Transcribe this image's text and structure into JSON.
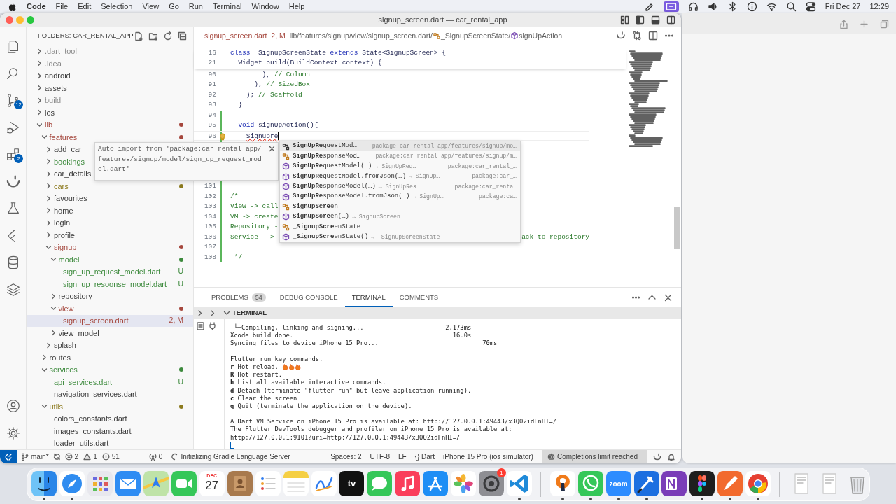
{
  "menu_bar": {
    "app": "Code",
    "items": [
      "File",
      "Edit",
      "Selection",
      "View",
      "Go",
      "Run",
      "Terminal",
      "Window",
      "Help"
    ],
    "date": "Fri Dec 27",
    "time": "12:29"
  },
  "window": {
    "title": "signup_screen.dart — car_rental_app"
  },
  "activity_bar": [
    {
      "kind": "files"
    },
    {
      "kind": "search"
    },
    {
      "kind": "source_control",
      "badge": "12"
    },
    {
      "kind": "run"
    },
    {
      "kind": "extensions",
      "badge": "2"
    },
    {
      "kind": "smile"
    },
    {
      "kind": "testing"
    },
    {
      "kind": "flutter"
    },
    {
      "kind": "database"
    },
    {
      "kind": "layers"
    }
  ],
  "activity_bottom": [
    {
      "kind": "account"
    },
    {
      "kind": "settings"
    }
  ],
  "sidebar": {
    "title": "FOLDERS: CAR_RENTAL_APP",
    "tree": [
      {
        "label": ".dart_tool",
        "kind": "folder",
        "expanded": false,
        "selected": false,
        "color": "#8a8a8a"
      },
      {
        "label": ".idea",
        "kind": "folder",
        "expanded": false,
        "selected": false,
        "color": "#8a8a8a"
      },
      {
        "label": "android",
        "kind": "folder",
        "expanded": false,
        "selected": false
      },
      {
        "label": "assets",
        "kind": "folder",
        "expanded": false,
        "selected": false
      },
      {
        "label": "build",
        "kind": "folder",
        "expanded": false,
        "selected": false,
        "color": "#8a8a8a"
      },
      {
        "label": "ios",
        "kind": "folder",
        "expanded": false,
        "selected": false
      },
      {
        "label": "lib",
        "kind": "folder",
        "expanded": true,
        "selected": false,
        "color": "#a5473d",
        "dot": true,
        "children": [
          {
            "label": "features",
            "kind": "folder",
            "expanded": true,
            "selected": false,
            "color": "#a5473d",
            "dot": true,
            "children": [
              {
                "label": "add_car",
                "kind": "folder",
                "expanded": false,
                "selected": false
              },
              {
                "label": "bookings",
                "kind": "folder",
                "expanded": false,
                "selected": false,
                "color": "#3d8a3d"
              },
              {
                "label": "car_details",
                "kind": "folder",
                "expanded": false,
                "selected": false
              },
              {
                "label": "cars",
                "kind": "folder",
                "expanded": false,
                "selected": false,
                "color": "#8c7a1e",
                "dot": true
              },
              {
                "label": "favourites",
                "kind": "folder",
                "expanded": false,
                "selected": false
              },
              {
                "label": "home",
                "kind": "folder",
                "expanded": false,
                "selected": false
              },
              {
                "label": "login",
                "kind": "folder",
                "expanded": false,
                "selected": false
              },
              {
                "label": "profile",
                "kind": "folder",
                "expanded": false,
                "selected": false
              },
              {
                "label": "signup",
                "kind": "folder",
                "expanded": true,
                "selected": false,
                "color": "#a5473d",
                "dot": true,
                "children": [
                  {
                    "label": "model",
                    "kind": "folder",
                    "expanded": true,
                    "selected": false,
                    "color": "#3d8a3d",
                    "dot": true,
                    "children": [
                      {
                        "label": "sign_up_request_model.dart",
                        "kind": "file",
                        "selected": false,
                        "color": "#3d8a3d",
                        "badge": "U"
                      },
                      {
                        "label": "sign_up_resoonse_model.dart",
                        "kind": "file",
                        "selected": false,
                        "color": "#3d8a3d",
                        "badge": "U"
                      }
                    ]
                  },
                  {
                    "label": "repository",
                    "kind": "folder",
                    "expanded": false,
                    "selected": false
                  },
                  {
                    "label": "view",
                    "kind": "folder",
                    "expanded": true,
                    "selected": false,
                    "color": "#a5473d",
                    "dot": true,
                    "children": [
                      {
                        "label": "signup_screen.dart",
                        "kind": "file",
                        "selected": true,
                        "color": "#a5473d",
                        "badge": "2, M"
                      }
                    ]
                  },
                  {
                    "label": "view_model",
                    "kind": "folder",
                    "expanded": false,
                    "selected": false
                  }
                ]
              },
              {
                "label": "splash",
                "kind": "folder",
                "expanded": false,
                "selected": false
              }
            ]
          },
          {
            "label": "routes",
            "kind": "folder",
            "expanded": false,
            "selected": false
          },
          {
            "label": "services",
            "kind": "folder",
            "expanded": true,
            "selected": false,
            "color": "#3d8a3d",
            "dot": true,
            "children": [
              {
                "label": "api_services.dart",
                "kind": "file",
                "selected": false,
                "color": "#3d8a3d",
                "badge": "U"
              },
              {
                "label": "navigation_services.dart",
                "kind": "file",
                "selected": false
              }
            ]
          },
          {
            "label": "utils",
            "kind": "folder",
            "expanded": true,
            "selected": false,
            "color": "#8c7a1e",
            "dot": true,
            "children": [
              {
                "label": "colors_constants.dart",
                "kind": "file",
                "selected": false
              },
              {
                "label": "images_constants.dart",
                "kind": "file",
                "selected": false
              },
              {
                "label": "loader_utils.dart",
                "kind": "file",
                "selected": false
              }
            ]
          }
        ]
      }
    ]
  },
  "editor": {
    "file": "signup_screen.dart",
    "file_status": "2, M",
    "breadcrumb": [
      "lib/features/signup/view/signup_screen.dart/",
      "_SignupScreenState/",
      "signUpAction"
    ],
    "sticky_lines": [
      {
        "number": "16",
        "tokens": [
          {
            "text": "class",
            "kind": "keyword"
          },
          {
            "text": " _SignupScreenState ",
            "kind": "plain"
          },
          {
            "text": "extends",
            "kind": "keyword"
          },
          {
            "text": " State<SignupScreen> {",
            "kind": "plain"
          }
        ]
      },
      {
        "number": "21",
        "tokens": [
          {
            "text": "  Widget build(BuildContext context) {",
            "kind": "plain"
          }
        ]
      }
    ],
    "lines": [
      {
        "number": "90",
        "changed": false,
        "tokens": [
          {
            "text": "        ), ",
            "kind": "plain"
          },
          {
            "text": "// Column",
            "kind": "comment"
          }
        ]
      },
      {
        "number": "91",
        "changed": false,
        "tokens": [
          {
            "text": "      ), ",
            "kind": "plain"
          },
          {
            "text": "// SizedBox",
            "kind": "comment"
          }
        ]
      },
      {
        "number": "92",
        "changed": false,
        "tokens": [
          {
            "text": "    ); ",
            "kind": "plain"
          },
          {
            "text": "// Scaffold",
            "kind": "comment"
          }
        ]
      },
      {
        "number": "93",
        "changed": false,
        "tokens": [
          {
            "text": "  }",
            "kind": "plain"
          }
        ]
      },
      {
        "number": "94",
        "changed": true
      },
      {
        "number": "95",
        "changed": true,
        "tokens": [
          {
            "text": "  void",
            "kind": "keyword"
          },
          {
            "text": " signUpAction(){",
            "kind": "plain"
          }
        ]
      },
      {
        "number": "96",
        "changed": true,
        "current": true,
        "lightbulb": true,
        "tokens": [
          {
            "text": "    Signupre",
            "kind": "error"
          }
        ]
      },
      {
        "number": "101",
        "changed": true,
        "after_covered_rows": true
      },
      {
        "number": "102",
        "changed": true,
        "tokens": [
          {
            "text": "/*",
            "kind": "comment"
          }
        ]
      },
      {
        "number": "103",
        "changed": true,
        "tokens": [
          {
            "text": "View -> call",
            "kind": "comment"
          }
        ]
      },
      {
        "number": "104",
        "changed": true,
        "tokens": [
          {
            "text": "VM -> create",
            "kind": "comment"
          }
        ]
      },
      {
        "number": "105",
        "changed": true,
        "tokens": [
          {
            "text": "Repository -",
            "kind": "comment"
          }
        ]
      },
      {
        "number": "106",
        "changed": true,
        "tokens": [
          {
            "text": "Service  ->",
            "kind": "comment"
          }
        ],
        "tail": "ack to repository"
      },
      {
        "number": "107",
        "changed": true
      },
      {
        "number": "108",
        "changed": true,
        "tokens": [
          {
            "text": " */",
            "kind": "comment"
          }
        ]
      }
    ],
    "hover": {
      "text": "Auto import from 'package:car_rental_app/\nfeatures/signup/model/sign_up_request_mod\nel.dart'"
    },
    "suggestions": [
      {
        "kind": "class",
        "label": "**SignUpRe**questMod…",
        "source": "package:car_rental_app/features/signup/mo…",
        "selected": true
      },
      {
        "kind": "class",
        "label": "**SignUpRe**sponseMod…",
        "source": "package:car_rental_app/features/signup/m…",
        "selected": false
      },
      {
        "kind": "constructor",
        "label": "**SignUpRe**questModel(…)",
        "detail": "→ SignUpReq…",
        "source": "package:car_rental_…",
        "selected": false
      },
      {
        "kind": "constructor",
        "label": "**SignUpRe**questModel.fromJson(…)",
        "detail": "→ SignUp…",
        "source": "package:car_…",
        "selected": false
      },
      {
        "kind": "constructor",
        "label": "**SignUpRe**sponseModel(…)",
        "detail": "→ SignUpRes…",
        "source": "package:car_renta…",
        "selected": false
      },
      {
        "kind": "constructor",
        "label": "**SignUpRe**sponseModel.fromJson(…)",
        "detail": "→ SignUp…",
        "source": "package:ca…",
        "selected": false
      },
      {
        "kind": "class",
        "label": "**SignupScre**en",
        "selected": false
      },
      {
        "kind": "constructor",
        "label": "**SignupScre**en(…)",
        "detail": "→ SignupScreen",
        "selected": false
      },
      {
        "kind": "class",
        "label": "**_SignupScre**enState",
        "selected": false
      },
      {
        "kind": "constructor",
        "label": "**_SignupScre**enState()",
        "detail": "→ _SignupScreenState",
        "selected": false
      }
    ]
  },
  "panel": {
    "tabs": [
      {
        "label": "PROBLEMS",
        "badge": "54",
        "selected": false
      },
      {
        "label": "DEBUG CONSOLE",
        "selected": false
      },
      {
        "label": "TERMINAL",
        "selected": true
      },
      {
        "label": "COMMENTS",
        "selected": false
      }
    ],
    "section": "TERMINAL",
    "terminal_blocks": [
      [
        {
          "text": " └─Compiling, linking and signing...                      2,173ms"
        },
        {
          "text": "Xcode build done.                                           16.0s"
        },
        {
          "text": "Syncing files to device iPhone 15 Pro...                            70ms"
        }
      ],
      [
        {
          "text": "Flutter run key commands."
        },
        {
          "text": "**r** Hot reload.",
          "kind": "with_flames"
        },
        {
          "text": "**R** Hot restart."
        },
        {
          "text": "**h** List all available interactive commands."
        },
        {
          "text": "**d** Detach (terminate \"flutter run\" but leave application running)."
        },
        {
          "text": "**c** Clear the screen"
        },
        {
          "text": "**q** Quit (terminate the application on the device)."
        }
      ],
      [
        {
          "text": "A Dart VM Service on iPhone 15 Pro is available at: http://127.0.0.1:49443/x3QO2idFnHI=/"
        },
        {
          "text": "The Flutter DevTools debugger and profiler on iPhone 15 Pro is available at:"
        },
        {
          "text": "http://127.0.0.1:9101?uri=http://127.0.0.1:49443/x3QO2idFnHI=/"
        }
      ]
    ],
    "cursor": true
  },
  "status_bar": {
    "branch": "main*",
    "errors": "2",
    "warnings": "1",
    "infos": "51",
    "ports": "0",
    "task": "Initializing Gradle Language Server",
    "right": [
      "Spaces: 2",
      "UTF-8",
      "LF",
      "{} Dart",
      "iPhone 15 Pro (ios simulator)"
    ],
    "copilot": "Completions limit reached"
  },
  "dock": [
    {
      "kind": "finder",
      "running": true
    },
    {
      "kind": "safari",
      "running": true
    },
    {
      "kind": "launchpad",
      "running": false
    },
    {
      "kind": "mail",
      "running": false
    },
    {
      "kind": "maps",
      "running": false
    },
    {
      "kind": "facetime",
      "running": false
    },
    {
      "kind": "calendar",
      "month": "DEC",
      "day": "27",
      "running": false
    },
    {
      "kind": "contacts",
      "running": false
    },
    {
      "kind": "reminders",
      "running": false
    },
    {
      "kind": "notes",
      "running": false
    },
    {
      "kind": "freeform",
      "running": false
    },
    {
      "kind": "tv",
      "label": "tv",
      "running": false
    },
    {
      "kind": "messages",
      "running": false
    },
    {
      "kind": "music",
      "running": false
    },
    {
      "kind": "appstore",
      "running": false
    },
    {
      "kind": "photos",
      "running": false
    },
    {
      "kind": "settings",
      "badge": "1",
      "running": false
    },
    {
      "kind": "vscode",
      "running": true
    },
    {
      "kind": "separator"
    },
    {
      "kind": "vpn",
      "running": true
    },
    {
      "kind": "whatsapp",
      "running": true
    },
    {
      "kind": "zoom",
      "label": "zoom",
      "running": true
    },
    {
      "kind": "xcode",
      "running": true
    },
    {
      "kind": "onenote",
      "running": false
    },
    {
      "kind": "figma",
      "running": true
    },
    {
      "kind": "pen",
      "running": true
    },
    {
      "kind": "chrome",
      "running": true
    },
    {
      "kind": "separator"
    },
    {
      "kind": "document",
      "running": false
    },
    {
      "kind": "document",
      "running": false
    },
    {
      "kind": "trash",
      "running": false
    }
  ]
}
